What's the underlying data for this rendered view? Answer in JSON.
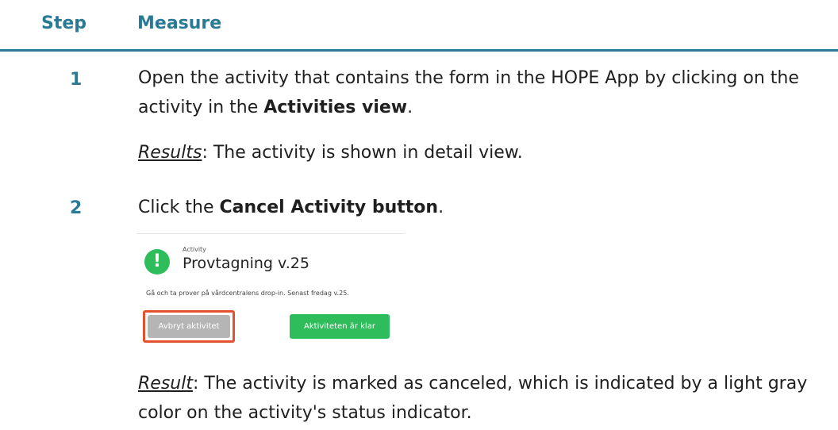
{
  "header": {
    "step": "Step",
    "measure": "Measure"
  },
  "steps": [
    {
      "number": "1",
      "text_pre": "Open the activity that contains the form in the HOPE App by clicking on the activity in the ",
      "text_bold": "Activities view",
      "text_post": ".",
      "result_label": "Results",
      "result_text": ": The activity is shown in detail view."
    },
    {
      "number": "2",
      "text_pre": "Click the ",
      "text_bold": "Cancel Activity button",
      "text_post": ".",
      "result_label": "Result",
      "result_text": ": The activity is marked as canceled, which is indicated by a light gray color on the activity's status indicator."
    }
  ],
  "screenshot": {
    "icon_glyph": "!",
    "label": "Activity",
    "title": "Provtagning v.25",
    "description": "Gå och ta prover på vårdcentralens drop-in. Senast fredag v.25.",
    "cancel_button": "Avbryt aktivitet",
    "done_button": "Aktiviteten är klar",
    "colors": {
      "accent_green": "#2ebd5a",
      "cancel_gray": "#b5b5b5",
      "highlight_red": "#e4512f"
    }
  },
  "colors": {
    "heading_teal": "#2a7a96"
  }
}
